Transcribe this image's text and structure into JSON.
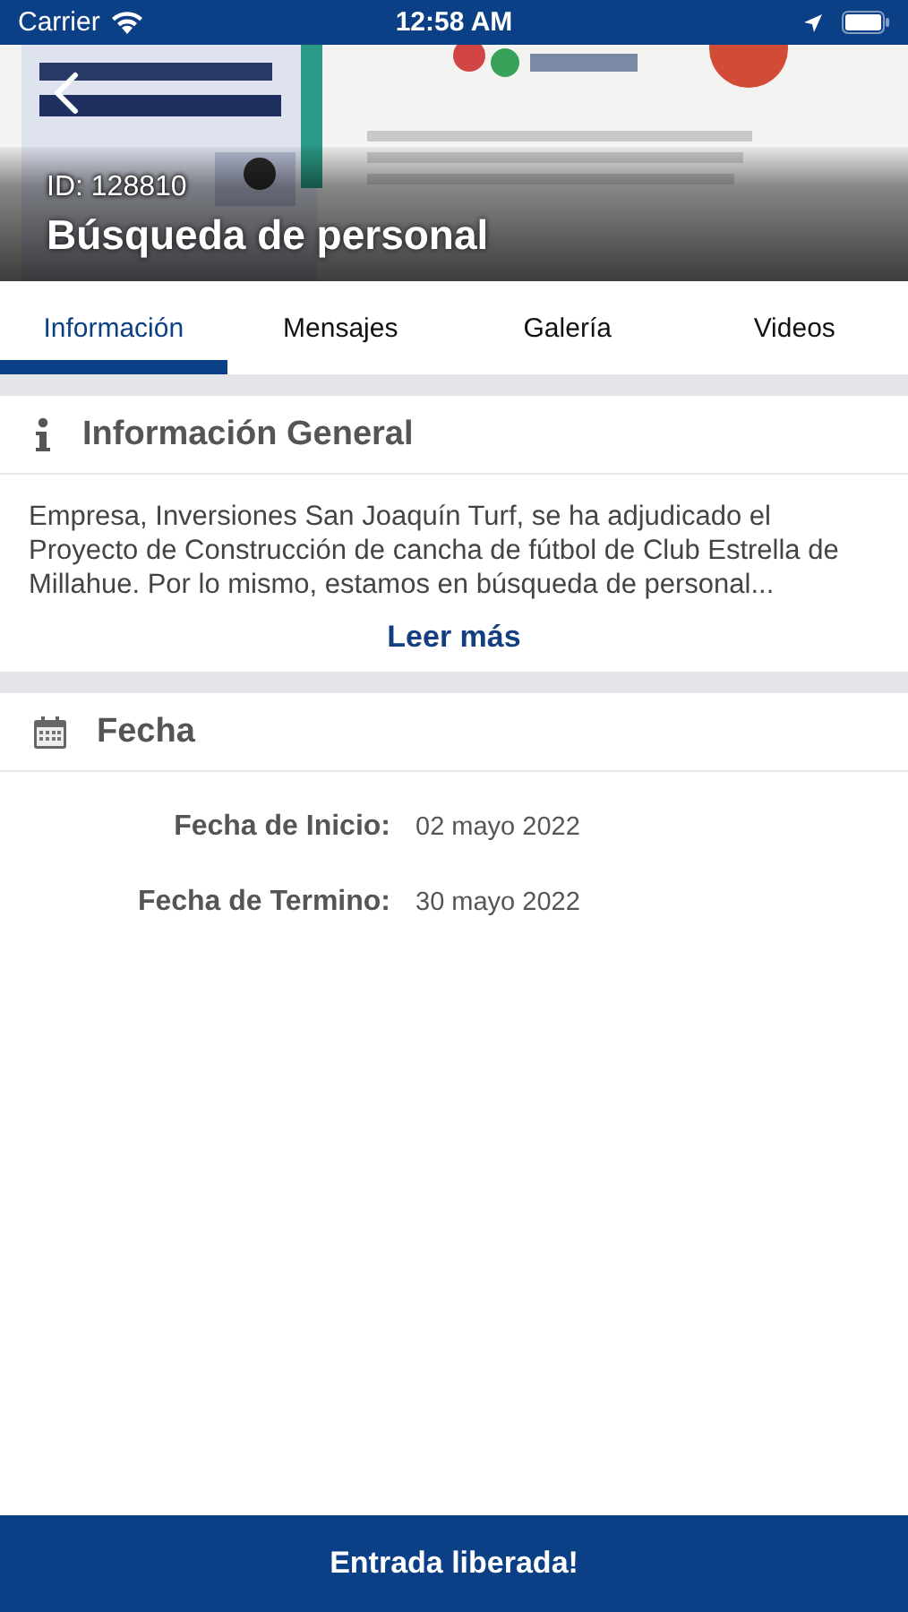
{
  "status_bar": {
    "carrier": "Carrier",
    "time": "12:58 AM"
  },
  "header": {
    "kind": "picture",
    "id_label": "ID: 128810",
    "title": "Búsqueda de personal"
  },
  "tabs": [
    {
      "label": "Información",
      "selected": true
    },
    {
      "label": "Mensajes",
      "selected": false
    },
    {
      "label": "Galería",
      "selected": false
    },
    {
      "label": "Videos",
      "selected": false
    }
  ],
  "general": {
    "title": "Información General",
    "description": "Empresa, Inversiones San Joaquín Turf, se ha adjudicado el Proyecto de Construcción de cancha de fútbol de Club Estrella de Millahue. Por lo mismo, estamos en búsqueda de personal...",
    "read_more": "Leer más"
  },
  "dates": {
    "title": "Fecha",
    "rows": [
      {
        "label": "Fecha de Inicio:",
        "value": "02 mayo 2022"
      },
      {
        "label": "Fecha de Termino:",
        "value": "30 mayo 2022"
      }
    ]
  },
  "footer_button": "Entrada liberada!"
}
